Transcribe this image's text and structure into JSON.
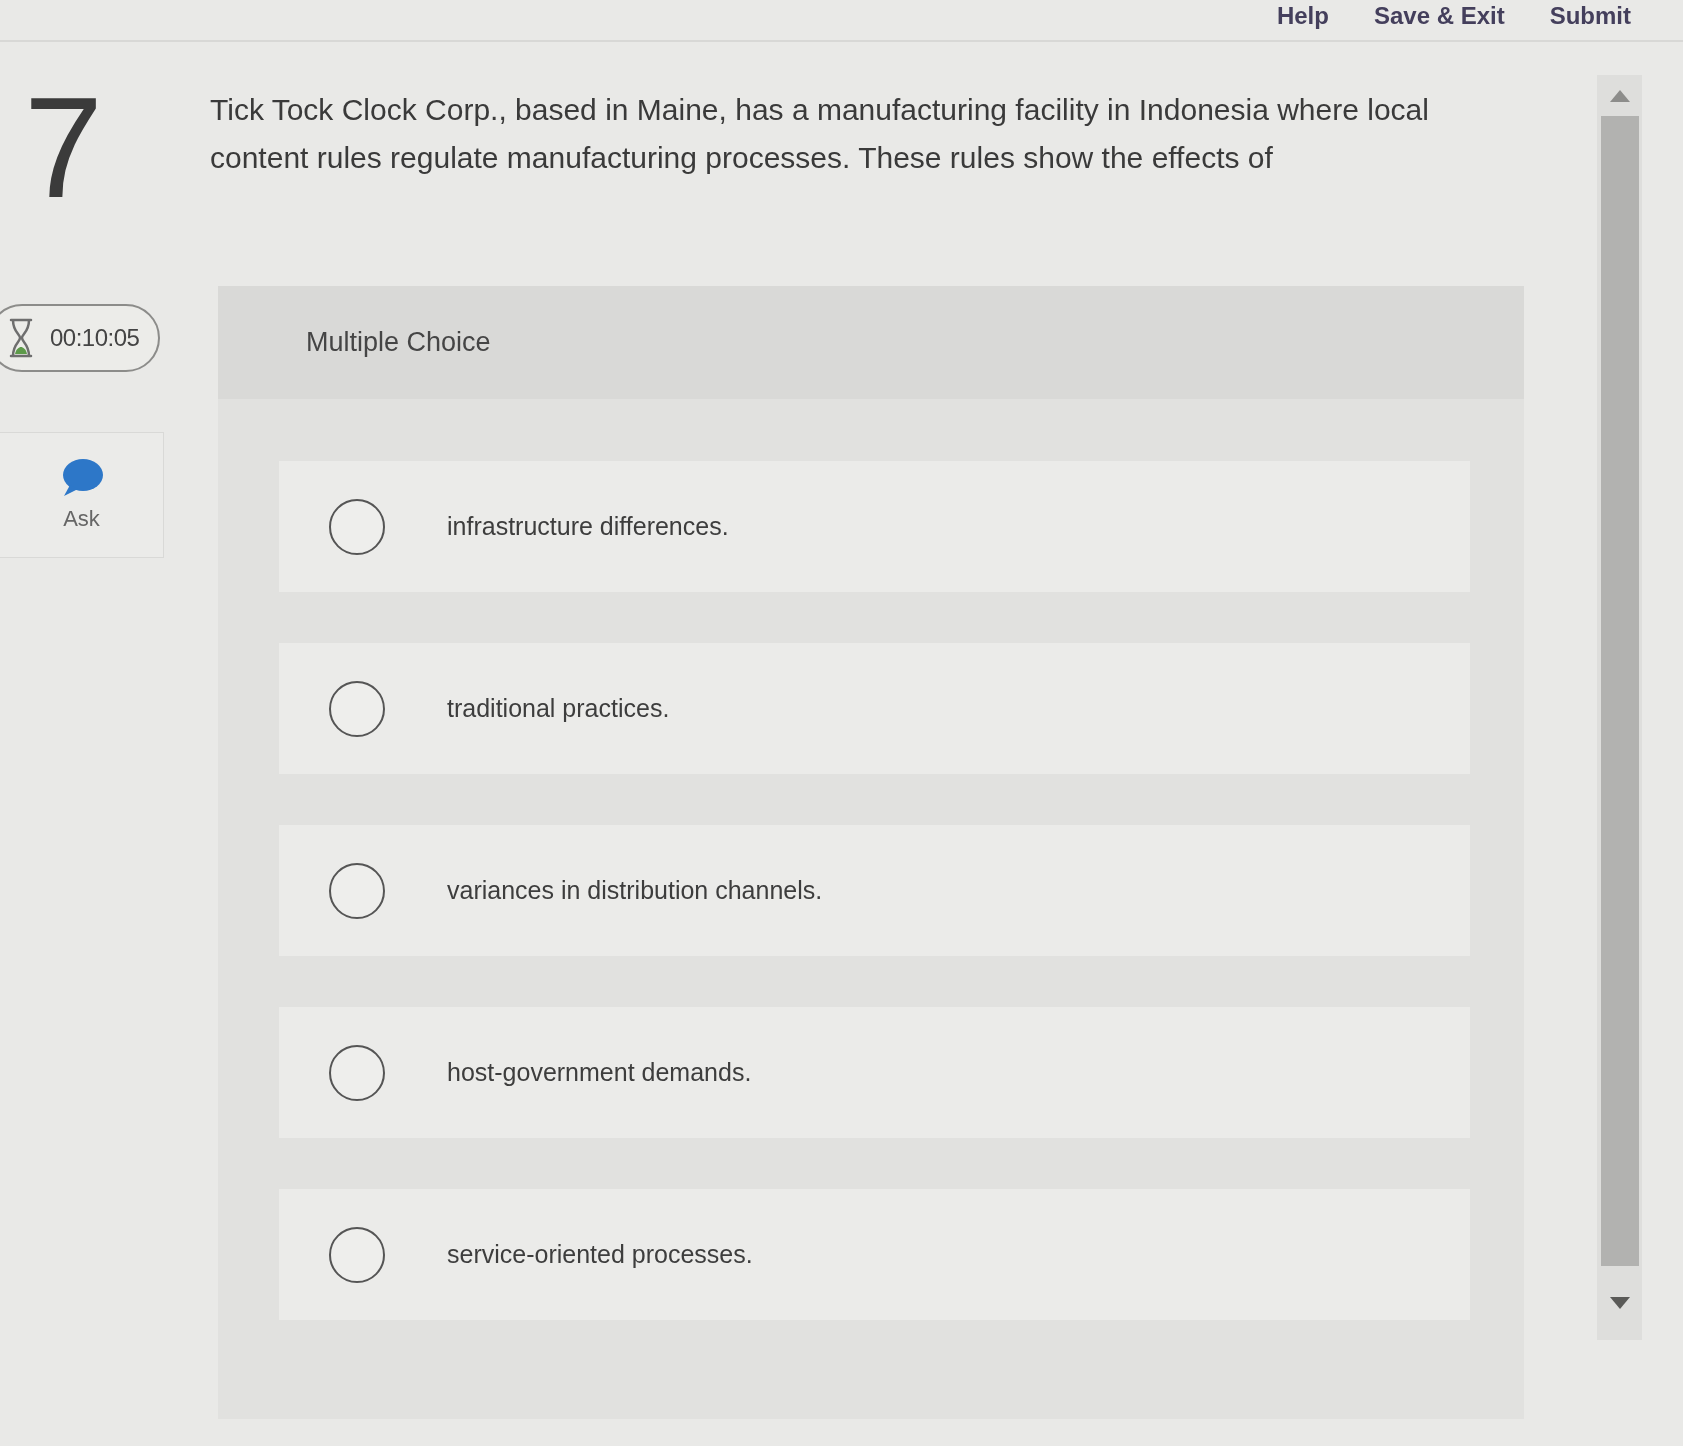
{
  "top_nav": {
    "links": [
      {
        "label": "Help"
      },
      {
        "label": "Save & Exit"
      },
      {
        "label": "Submit"
      }
    ]
  },
  "question": {
    "number": "7",
    "text": "Tick Tock Clock Corp., based in Maine, has a manufacturing facility in Indonesia where local content rules regulate manufacturing processes. These rules show the effects of"
  },
  "timer": {
    "time": "00:10:05"
  },
  "ask": {
    "label": "Ask"
  },
  "answer_panel": {
    "title": "Multiple Choice",
    "options": [
      {
        "label": "infrastructure differences.",
        "selected": false
      },
      {
        "label": "traditional practices.",
        "selected": false
      },
      {
        "label": "variances in distribution channels.",
        "selected": false
      },
      {
        "label": "host-government demands.",
        "selected": false
      },
      {
        "label": "service-oriented processes.",
        "selected": false
      }
    ]
  }
}
